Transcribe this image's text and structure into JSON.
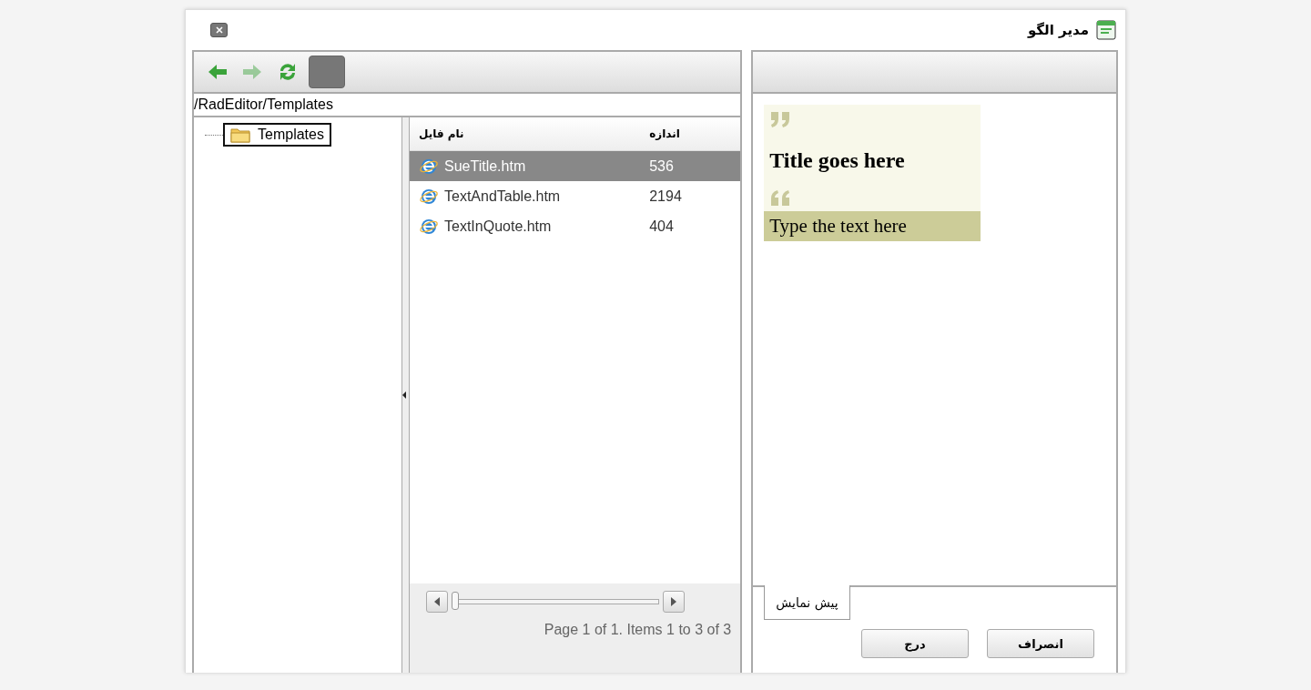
{
  "window": {
    "title": "مدیر الگو"
  },
  "toolbar": {
    "buttons": [
      {
        "kind": "back",
        "disabled": false
      },
      {
        "kind": "forward",
        "disabled": true
      },
      {
        "kind": "refresh",
        "disabled": false
      },
      {
        "kind": "blank",
        "disabled": false
      }
    ]
  },
  "path": "/RadEditor/Templates",
  "tree": {
    "items": [
      {
        "label": "Templates",
        "selected": true
      }
    ]
  },
  "grid": {
    "columns": [
      "اندازه",
      "نام فایل"
    ],
    "rows": [
      {
        "name": "SueTitle.htm",
        "size": "536",
        "selected": true
      },
      {
        "name": "TextAndTable.htm",
        "size": "2194",
        "selected": false
      },
      {
        "name": "TextInQuote.htm",
        "size": "404",
        "selected": false
      }
    ],
    "pager": "Page 1 of 1. Items 1 to 3 of 3",
    "pager_slider": {
      "level": 0
    }
  },
  "preview": {
    "title": "Title goes here",
    "body": "Type the text here"
  },
  "tabs": [
    {
      "label": "پیش نمایش",
      "selected": true
    }
  ],
  "buttons": [
    "انصراف",
    "درج"
  ]
}
